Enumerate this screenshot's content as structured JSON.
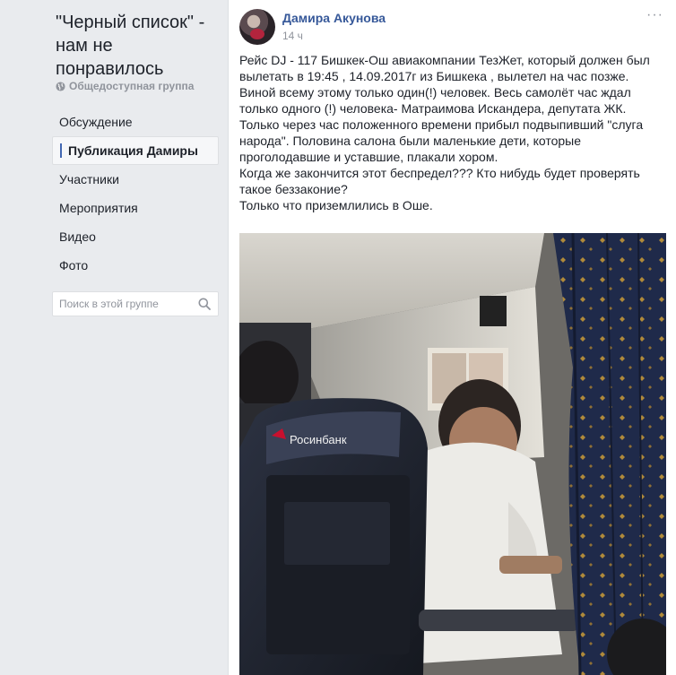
{
  "group": {
    "title": "\"Черный список\" - нам не понравилось",
    "type_label": "Общедоступная группа"
  },
  "nav": {
    "items": [
      {
        "label": "Обсуждение",
        "active": false
      },
      {
        "label": "Публикация Дамиры",
        "active": true
      },
      {
        "label": "Участники",
        "active": false
      },
      {
        "label": "Мероприятия",
        "active": false
      },
      {
        "label": "Видео",
        "active": false
      },
      {
        "label": "Фото",
        "active": false
      }
    ]
  },
  "search": {
    "placeholder": "Поиск в этой группе",
    "value": ""
  },
  "post": {
    "author": "Дамира Акунова",
    "time": "14 ч",
    "more_label": "···",
    "paragraphs": [
      "Рейс DJ - 117 Бишкек-Ош авиакомпании ТезЖет, который должен был вылетать в 19:45 , 14.09.2017г из Бишкека , вылетел на час позже. Виной всему этому только один(!) человек. Весь самолёт час ждал только одного (!) человека- Матраимова Искандера, депутата ЖК. Только через час положенного времени прибыл подвыпивший \"слуга народа\". Половина салона были маленькие дети, которые проголодавшие и уставшие, плакали хором.",
      "Когда же закончится этот беспредел??? Кто нибудь будет проверять такое беззаконие?",
      "Только что приземлились в Оше."
    ],
    "photo": {
      "seat_brand": "Росинбанк"
    }
  },
  "colors": {
    "link": "#365899",
    "accent": "#4267b2",
    "muted": "#90949c",
    "page_bg": "#e9ebee"
  }
}
